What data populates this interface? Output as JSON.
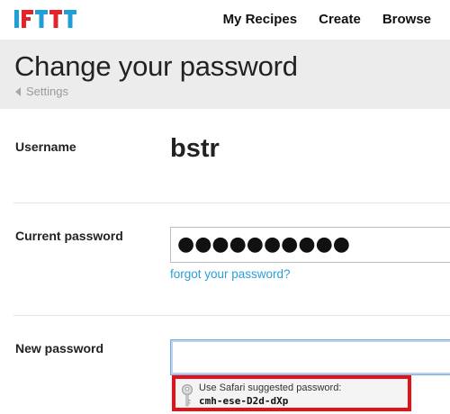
{
  "brand": {
    "logo_text": "IFTTT"
  },
  "nav": {
    "items": [
      {
        "label": "My Recipes"
      },
      {
        "label": "Create"
      },
      {
        "label": "Browse"
      }
    ]
  },
  "header": {
    "title": "Change your password",
    "breadcrumb": "Settings"
  },
  "form": {
    "username_label": "Username",
    "username_value": "bstr",
    "current_password_label": "Current password",
    "current_password_value": "●●●●●●●●●●",
    "forgot_link": "forgot your password?",
    "new_password_label": "New password",
    "new_password_value": ""
  },
  "suggestion": {
    "line1": "Use Safari suggested password:",
    "line2": "cmh-ese-D2d-dXp",
    "highlight_color": "#e3121a"
  },
  "colors": {
    "logo_blue": "#1e9fd9",
    "logo_red": "#e2232a",
    "link": "#2a9fd6",
    "header_bg": "#ececec"
  }
}
